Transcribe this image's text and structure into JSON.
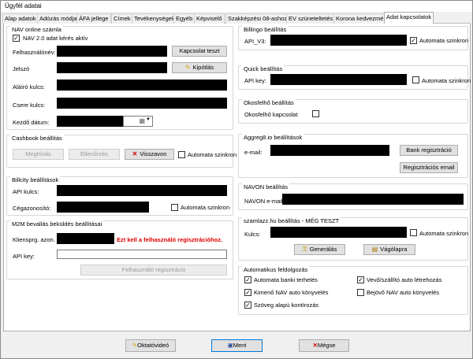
{
  "window": {
    "title": "Ügyfél adatai"
  },
  "tabs": [
    {
      "label": "Alap adatok"
    },
    {
      "label": "Adózás módja"
    },
    {
      "label": "ÁFA jellege"
    },
    {
      "label": "Címek"
    },
    {
      "label": "Tevékenységek"
    },
    {
      "label": "Egyéb"
    },
    {
      "label": "Képviselő"
    },
    {
      "label": "Szakképzési 08-ashoz"
    },
    {
      "label": "EV szüneteltetés"
    },
    {
      "label": "Korona kedvezmény"
    },
    {
      "label": "Adat kapcsolatok"
    }
  ],
  "nav": {
    "title": "NAV online számla",
    "enable_label": "NAV 2.0 adat kérés aktív",
    "enable_checked": true,
    "username_label": "Felhasználónév:",
    "password_label": "Jelszó",
    "signkey_label": "Aláíró kulcs:",
    "exchangekey_label": "Csere kulcs:",
    "startdate_label": "Kezdő dátum:",
    "test_button": "Kapcsolat teszt",
    "fill_button": "Kipótlás"
  },
  "cashbook": {
    "title": "Cashbook beállítás",
    "view_button": "Meghívás",
    "check_button": "Ellenőrzés",
    "revoke_button": "Visszavon",
    "auto_sync_label": "Automata szinkron"
  },
  "billcity": {
    "title": "Billcity beállítások",
    "apikey_label": "API kulcs:",
    "company_label": "Cégazonosító:",
    "auto_sync_label": "Automata szinkron"
  },
  "m2m": {
    "title": "M2M bevallás beküldés beállításai",
    "client_label": "Kliensprg. azon.",
    "warning": "Ezt kell a felhasználó regisztrációhoz.",
    "apikey_label": "API key:",
    "register_button": "Felhasználó regisztráció"
  },
  "billingo": {
    "title": "Billingo beállítás",
    "api_label": "API_V3:",
    "auto_sync_label": "Automata szinkron",
    "auto_sync_checked": true
  },
  "quick": {
    "title": "Quick beállítás",
    "apikey_label": "API key:",
    "auto_sync_label": "Automata szinkron"
  },
  "okosfelho": {
    "title": "Okosfelhő beállítás",
    "connect_label": "Okosfelhő kapcsolat"
  },
  "aggreg8": {
    "title": "Aggreg8.io beállítások",
    "email_label": "e-mail:",
    "bank_button": "Bank regisztráció",
    "email_button": "Regisztrációs email"
  },
  "navon": {
    "title": "NAVON beállítás",
    "email_label": "NAVON e-mail:"
  },
  "szamlazz": {
    "title": "szamlazz.hu beállítás - MÉG TESZT",
    "key_label": "Kulcs:",
    "auto_sync_label": "Automata szinkron",
    "generate_button": "Generálás",
    "clipboard_button": "Vágólapra"
  },
  "auto": {
    "title": "Automatikus feldolgozás",
    "items": [
      {
        "label": "Automata banki terhelés",
        "checked": true
      },
      {
        "label": "Vevő/szállító auto létrehozás",
        "checked": true
      },
      {
        "label": "Kimenő NAV auto könyvelés",
        "checked": true
      },
      {
        "label": "Bejövő NAV auto könyvelés",
        "checked": false
      },
      {
        "label": "Szöveg alapú kontírozás",
        "checked": true
      }
    ]
  },
  "footer": {
    "tutorial_button": "Oktatóvideó",
    "save_button": "Ment",
    "cancel_button": "Mégse"
  },
  "colors": {
    "warning": "#e00000",
    "accent": "#0078d7"
  },
  "icons": {
    "fill": "pencil-icon",
    "revoke": "x-icon",
    "generate": "key-icon",
    "clipboard": "clipboard-icon",
    "tutorial": "pencil-icon",
    "save": "floppy-icon",
    "cancel": "x-icon"
  }
}
